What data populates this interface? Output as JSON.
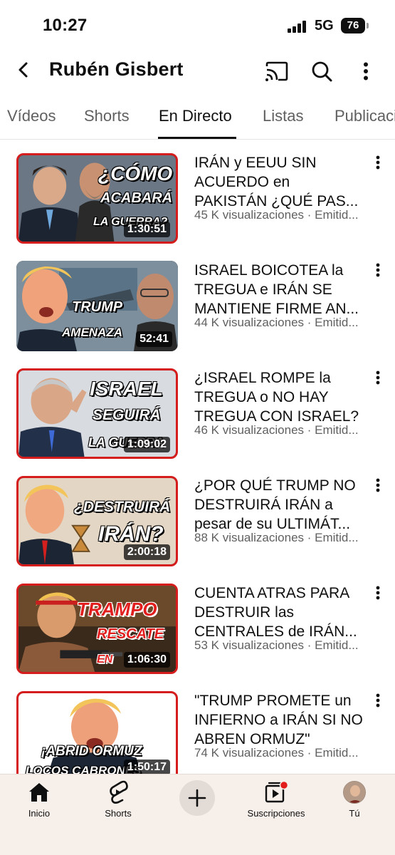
{
  "status_bar": {
    "time": "10:27",
    "network": "5G",
    "battery": "76"
  },
  "header": {
    "channel_name": "Rubén Gisbert",
    "icons": [
      "back-arrow-icon",
      "cast-icon",
      "search-icon",
      "more-vertical-icon"
    ]
  },
  "tabs": [
    {
      "label": "Vídeos",
      "active": false
    },
    {
      "label": "Shorts",
      "active": false
    },
    {
      "label": "En Directo",
      "active": true
    },
    {
      "label": "Listas",
      "active": false
    },
    {
      "label": "Publicaciones",
      "active": false
    }
  ],
  "videos": [
    {
      "title": "IRÁN y EEUU  SIN ACUERDO en PAKISTÁN ¿QUÉ PAS...",
      "meta": "45 K visualizaciones · Emitid...",
      "duration": "1:30:51",
      "thumb_text": [
        "¿CÓMO",
        "ACABARÁ",
        "LA GUERRA?"
      ]
    },
    {
      "title": "ISRAEL BOICOTEA la TREGUA e IRÁN SE MANTIENE FIRME AN...",
      "meta": "44 K visualizaciones · Emitid...",
      "duration": "52:41",
      "thumb_text": [
        "TRUMP",
        "AMENAZA"
      ]
    },
    {
      "title": "¿ISRAEL ROMPE la TREGUA o NO HAY TREGUA CON ISRAEL?",
      "meta": "46 K visualizaciones · Emitid...",
      "duration": "1:09:02",
      "thumb_text": [
        "ISRAEL",
        "SEGUIRÁ",
        "LA GUERRA"
      ]
    },
    {
      "title": "¿POR QUÉ TRUMP NO DESTRUIRÁ IRÁN a pesar de su ULTIMÁT...",
      "meta": "88 K visualizaciones · Emitid...",
      "duration": "2:00:18",
      "thumb_text": [
        "¿DESTRUIRÁ",
        "IRÁN?"
      ]
    },
    {
      "title": "CUENTA ATRAS PARA DESTRUIR las CENTRALES de IRÁN...",
      "meta": "53 K visualizaciones · Emitid...",
      "duration": "1:06:30",
      "thumb_text": [
        "TRAMPO",
        "RESCATE",
        "EN"
      ]
    },
    {
      "title": "\"TRUMP PROMETE un INFIERNO a IRÁN SI NO ABREN ORMUZ\"",
      "meta": "74 K visualizaciones · Emitid...",
      "duration": "1:50:17",
      "thumb_text": [
        "¡ABRID ORMUZ",
        "LOCOS CABRONES"
      ]
    }
  ],
  "bottom_nav": {
    "items": [
      {
        "label": "Inicio",
        "icon": "home-icon"
      },
      {
        "label": "Shorts",
        "icon": "shorts-icon"
      },
      {
        "label": "",
        "icon": "plus-icon"
      },
      {
        "label": "Suscripciones",
        "icon": "subscriptions-icon"
      },
      {
        "label": "Tú",
        "icon": "avatar"
      }
    ]
  },
  "colors": {
    "accent": "#0f0f0f",
    "secondary_text": "#606060",
    "thumbnail_border": "#d61d1d",
    "nav_background": "#f6efea"
  }
}
